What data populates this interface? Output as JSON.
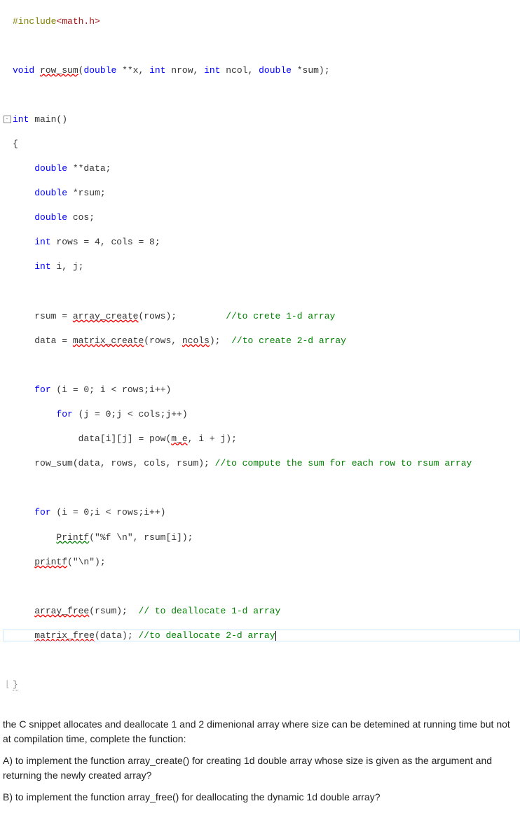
{
  "code": {
    "l1": "#include",
    "l1b": "<math.h>",
    "l2a": "void",
    "l2b": "row_sum",
    "l2c": "(",
    "l2d": "double",
    "l2e": " **x, ",
    "l2f": "int",
    "l2g": " nrow, ",
    "l2h": "int",
    "l2i": " ncol, ",
    "l2j": "double",
    "l2k": " *sum);",
    "l3a": "int",
    "l3b": " main()",
    "l4": "{",
    "l5a": "double",
    "l5b": " **data;",
    "l6a": "double",
    "l6b": " *rsum;",
    "l7a": "double",
    "l7b": " cos;",
    "l8a": "int",
    "l8b": " rows = 4, cols = 8;",
    "l9a": "int",
    "l9b": " i, j;",
    "l10a": "rsum = ",
    "l10b": "array_create",
    "l10c": "(rows);         ",
    "l10d": "//to crete 1-d array",
    "l11a": "data = ",
    "l11b": "matrix_create",
    "l11c": "(rows, ",
    "l11c2": "ncols",
    "l11c3": ");  ",
    "l11d": "//to create 2-d array",
    "l12a": "for",
    "l12b": " (i = 0; i < rows;i++)",
    "l13a": "for",
    "l13b": " (j = 0;j < cols;j++)",
    "l14a": "data[i][j] = pow(",
    "l14b": "m_e",
    "l14c": ", i + j);",
    "l15a": "row_sum(data, rows, cols, rsum); ",
    "l15b": "//to compute the sum for each row to rsum array",
    "l16a": "for",
    "l16b": " (i = 0;i < rows;i++)",
    "l17a": "Printf",
    "l17b": "(\"%f \\n\", rsum[i]);",
    "l18a": "printf",
    "l18b": "(\"\\n\");",
    "l19a": "array_free",
    "l19b": "(rsum);  ",
    "l19c": "// to deallocate 1-d array",
    "l20a": "matrix_free",
    "l20b": "(data); ",
    "l20c": "//to deallocate 2-d array",
    "l21": "}"
  },
  "question": {
    "p1": "the C snippet allocates and deallocate 1 and 2 dimenional array where size can be detemined at running time but not at compilation time, complete the function:",
    "p2": "A) to implement the function array_create() for creating 1d double array whose size is given as the argument and returning the newly created array?",
    "p3": "B) to implement the function array_free() for deallocating the dynamic 1d double array?"
  }
}
